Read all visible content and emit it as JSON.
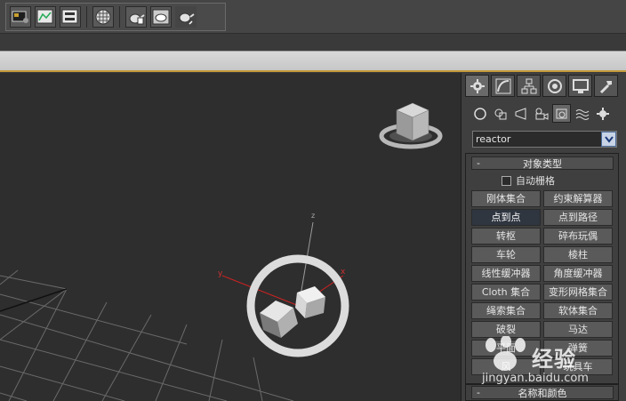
{
  "toolbar": {
    "icons": [
      "render-setup-icon",
      "rendered-frame-window-icon",
      "render-production-icon",
      "material-editor-icon",
      "teapot-render-icon",
      "teapot-frame-icon",
      "teapot-active-icon"
    ]
  },
  "panel": {
    "tab_icons": [
      "create-tab-icon",
      "modify-tab-icon",
      "hierarchy-tab-icon",
      "motion-tab-icon",
      "display-tab-icon",
      "utilities-tab-icon"
    ],
    "category_icons": [
      "geometry-icon",
      "shapes-icon",
      "lights-icon",
      "cameras-icon",
      "helpers-icon",
      "space-warps-icon",
      "systems-icon"
    ],
    "dropdown_value": "reactor",
    "object_type": {
      "minus": "-",
      "title": "对象类型",
      "autogrid_label": "自动栅格",
      "buttons": [
        "刚体集合",
        "约束解算器",
        "点到点",
        "点到路径",
        "转枢",
        "碎布玩偶",
        "车轮",
        "棱柱",
        "线性缓冲器",
        "角度缓冲器",
        "Cloth 集合",
        "变形网格集合",
        "绳索集合",
        "软体集合",
        "破裂",
        "马达",
        "平面",
        "弹簧",
        "风",
        "玩具车"
      ],
      "active_button": "点到点"
    },
    "name_color": {
      "minus": "-",
      "title": "名称和颜色"
    }
  },
  "viewport": {
    "gizmo_labels": {
      "z": "z",
      "y": "y",
      "x": "x"
    }
  },
  "watermark": {
    "brand": "经验",
    "url": "jingyan.baidu.com"
  },
  "colors": {
    "active_button": "#2f3640",
    "accent_strip": "#c49a3a",
    "dropdown_arrow": "#c8d4e6"
  }
}
